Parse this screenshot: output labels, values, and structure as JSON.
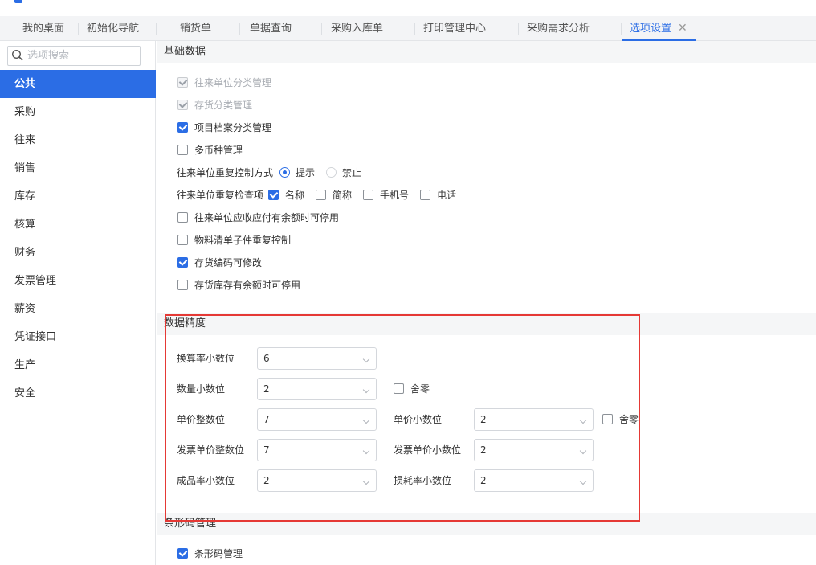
{
  "tabs": [
    {
      "label": "我的桌面",
      "active": false
    },
    {
      "label": "初始化导航",
      "active": false
    },
    {
      "label": "销货单",
      "active": false
    },
    {
      "label": "单据查询",
      "active": false
    },
    {
      "label": "采购入库单",
      "active": false
    },
    {
      "label": "打印管理中心",
      "active": false
    },
    {
      "label": "采购需求分析",
      "active": false
    },
    {
      "label": "选项设置",
      "active": true,
      "close": "✕"
    }
  ],
  "sidebar": {
    "search_placeholder": "选项搜索",
    "items": [
      {
        "label": "公共",
        "active": true
      },
      {
        "label": "采购"
      },
      {
        "label": "往来"
      },
      {
        "label": "销售"
      },
      {
        "label": "库存"
      },
      {
        "label": "核算"
      },
      {
        "label": "财务"
      },
      {
        "label": "发票管理"
      },
      {
        "label": "薪资"
      },
      {
        "label": "凭证接口"
      },
      {
        "label": "生产"
      },
      {
        "label": "安全"
      }
    ]
  },
  "basic": {
    "title": "基础数据",
    "opt_partner_class": {
      "label": "往来单位分类管理",
      "checked": true,
      "disabled": true
    },
    "opt_stock_class": {
      "label": "存货分类管理",
      "checked": true,
      "disabled": true
    },
    "opt_project_class": {
      "label": "项目档案分类管理",
      "checked": true
    },
    "opt_multi_currency": {
      "label": "多币种管理",
      "checked": false
    },
    "dup_mode": {
      "label": "往来单位重复控制方式",
      "prompt": "提示",
      "forbid": "禁止",
      "selected": "提示"
    },
    "dup_check": {
      "label": "往来单位重复检查项",
      "name": "名称",
      "short": "简称",
      "phone": "手机号",
      "tel": "电话"
    },
    "opt_partner_disable": {
      "label": "往来单位应收应付有余额时可停用",
      "checked": false
    },
    "opt_bom_dup": {
      "label": "物料清单子件重复控制",
      "checked": false
    },
    "opt_stock_code_edit": {
      "label": "存货编码可修改",
      "checked": true
    },
    "opt_stock_disable": {
      "label": "存货库存有余额时可停用",
      "checked": false
    }
  },
  "precision": {
    "title": "数据精度",
    "rate_decimals": {
      "label": "换算率小数位",
      "value": "6"
    },
    "qty_decimals": {
      "label": "数量小数位",
      "value": "2"
    },
    "qty_round": "舍零",
    "price_int": {
      "label": "单价整数位",
      "value": "7"
    },
    "price_decimals": {
      "label": "单价小数位",
      "value": "2"
    },
    "price_round": "舍零",
    "inv_price_int": {
      "label": "发票单价整数位",
      "value": "7"
    },
    "inv_price_decimals": {
      "label": "发票单价小数位",
      "value": "2"
    },
    "yield_decimals": {
      "label": "成品率小数位",
      "value": "2"
    },
    "loss_decimals": {
      "label": "损耗率小数位",
      "value": "2"
    }
  },
  "barcode": {
    "title": "条形码管理",
    "opt_barcode": {
      "label": "条形码管理",
      "checked": true
    }
  },
  "colors": {
    "accent": "#2b6de5",
    "highlight_box": "#e53935"
  }
}
